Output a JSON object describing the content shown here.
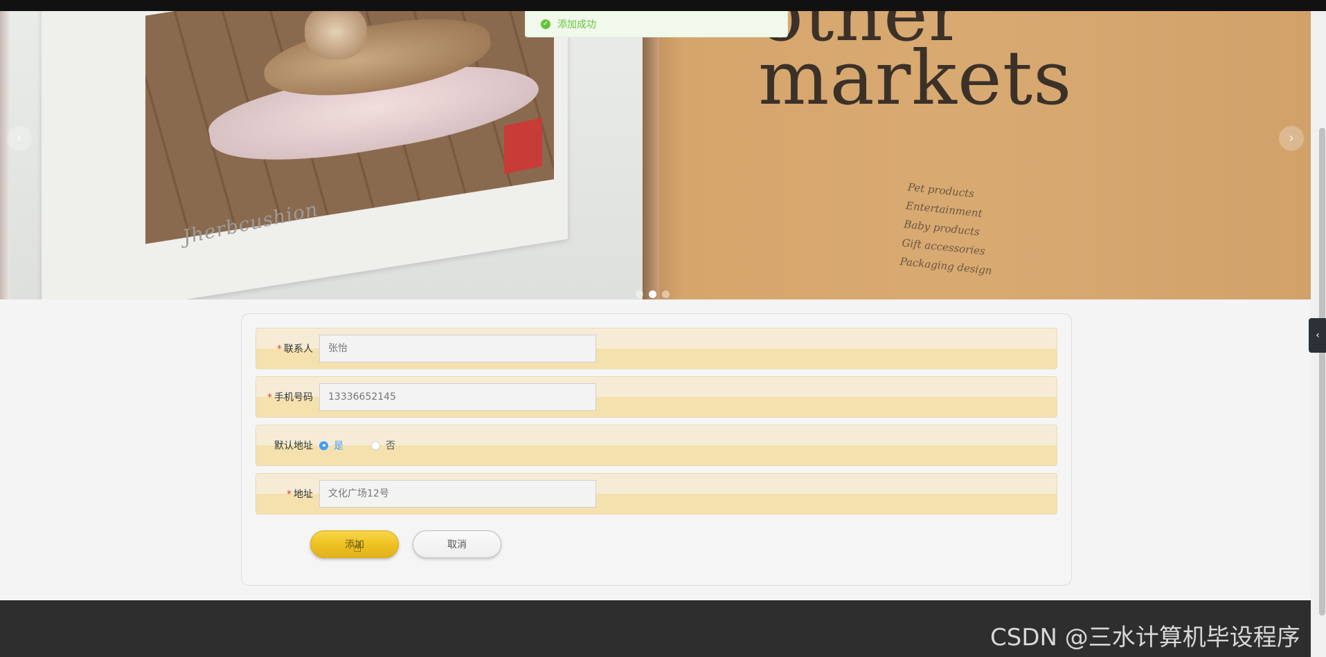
{
  "toast": {
    "message": "添加成功",
    "icon": "success-check-icon",
    "color": "#67c23a"
  },
  "banner": {
    "book_title_line1": "other",
    "book_title_line2": "markets",
    "book_list": [
      "Pet products",
      "Entertainment",
      "Baby products",
      "Gift accessories",
      "Packaging design"
    ],
    "page_script_text": "Jherbcushion",
    "slides": 3,
    "active_slide": 2
  },
  "form": {
    "contact": {
      "label": "联系人",
      "required": true,
      "placeholder": "张怡"
    },
    "phone": {
      "label": "手机号码",
      "required": true,
      "placeholder": "13336652145"
    },
    "default_address": {
      "label": "默认地址",
      "options": [
        "是",
        "否"
      ],
      "selected": "是"
    },
    "address": {
      "label": "地址",
      "required": true,
      "placeholder": "文化广场12号"
    },
    "submit_label": "添加",
    "cancel_label": "取消"
  },
  "watermark": "CSDN @三水计算机毕设程序",
  "colors": {
    "accent_yellow": "#eec222",
    "row_bg": "#f5e1ae",
    "radio_blue": "#409eff",
    "footer": "#2e2e2e"
  }
}
